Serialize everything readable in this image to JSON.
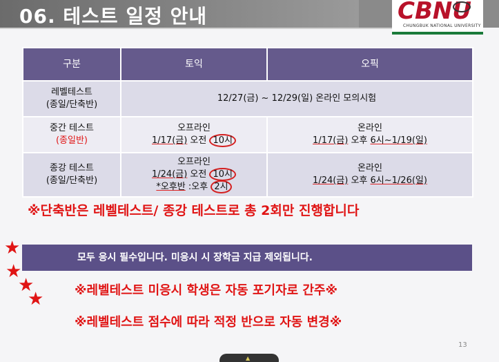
{
  "header": {
    "title": "06. 테스트 일정 안내",
    "logo_text": "CBNU",
    "logo_sub": "CHUNGBUK NATIONAL UNIVERSITY"
  },
  "table": {
    "headers": [
      "구분",
      "토익",
      "오픽"
    ],
    "rows": [
      {
        "label_line1": "레벨테스트",
        "label_line2": "(종일/단축반)",
        "merged": "12/27(금) ~ 12/29(일) 온라인 모의시험"
      },
      {
        "label_line1": "중간 테스트",
        "label_line2": "(종일반)",
        "toeic_line1": "오프라인",
        "toeic_line2_a": "1/17(금)",
        "toeic_line2_b": " 오전 ",
        "toeic_line2_c": "10시",
        "opic_line1": "온라인",
        "opic_line2_a": "1/17(금)",
        "opic_line2_b": " 오후 ",
        "opic_line2_c": "6시~1/19(일)"
      },
      {
        "label_line1": "종강 테스트",
        "label_line2": "(종일/단축반)",
        "toeic_line1": "오프라인",
        "toeic_line2_a": "1/24(금)",
        "toeic_line2_b": " 오전 ",
        "toeic_line2_c": "10시",
        "toeic_line3_a": "*오후반",
        "toeic_line3_b": " :오후 ",
        "toeic_line3_c": "2시",
        "opic_line1": "온라인",
        "opic_line2_a": "1/24(금)",
        "opic_line2_b": " 오후 ",
        "opic_line2_c": "6시~1/26(일)"
      }
    ]
  },
  "note": "※단축반은 레벨테스트/ 종강 테스트로 총 2회만 진행합니다",
  "banner": "모두 응시 필수입니다. 미응시 시  장학금 지급 제외됩니다.",
  "notices": [
    "※레벨테스트 미응시 학생은 자동 포기자로 간주※",
    "※레벨테스트 점수에 따라 적정 반으로 자동 변경※"
  ],
  "star_icon": "★",
  "page_number": "13",
  "colors": {
    "header_bg": "#655a8c",
    "accent_red": "#e01414",
    "banner_bg": "#5b5088"
  }
}
